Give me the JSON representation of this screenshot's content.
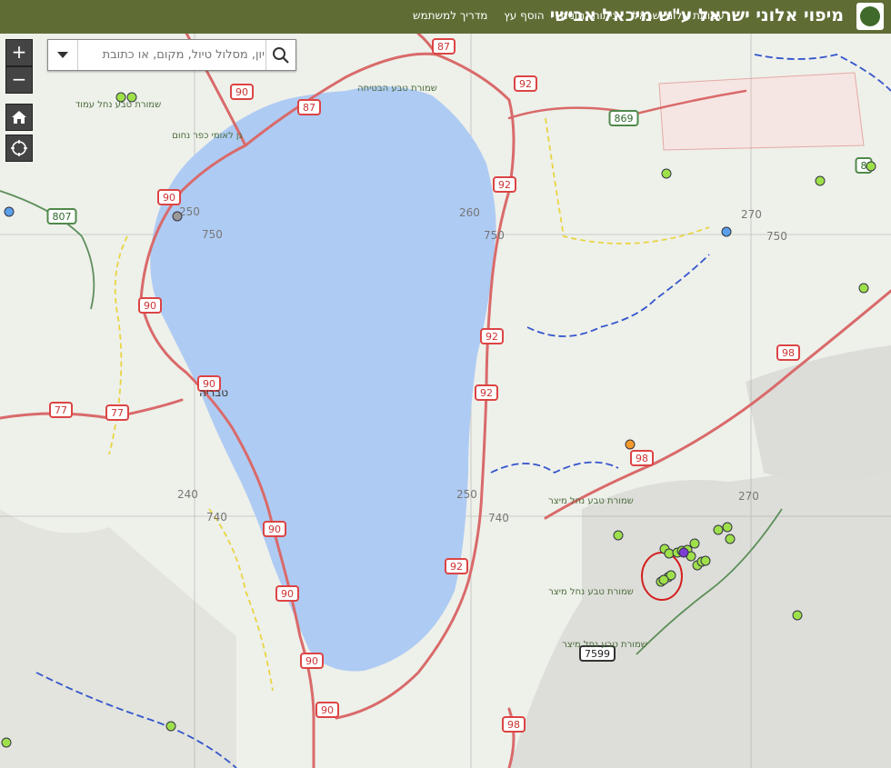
{
  "header": {
    "title": "מיפוי אלוני ישראל ע\"ש מיכאל אבישי",
    "nav": [
      "עמותת אלוני ישראל",
      "ניתוח נתונים",
      "הוסף עץ",
      "מדריך למשתמש"
    ]
  },
  "search": {
    "placeholder": "יון, מסלול טיול, מקום, או כתובת"
  },
  "controls": {
    "zoom_in": "+",
    "zoom_out": "−"
  },
  "map": {
    "lake_color": "#aecbf3",
    "road_color": "#d96a6a",
    "road_shields": [
      "87",
      "87",
      "90",
      "90",
      "90",
      "90",
      "90",
      "90",
      "90",
      "90",
      "92",
      "92",
      "92",
      "92",
      "92",
      "98",
      "98",
      "98",
      "77",
      "77",
      "807",
      "869",
      "7599",
      "8"
    ],
    "grid_labels": [
      "250",
      "260",
      "270",
      "750",
      "750",
      "750",
      "740",
      "740",
      "240",
      "270",
      "250"
    ],
    "place_labels": [
      "שמורת טבע נחל עמוד",
      "גן לאומי כפר נחום",
      "שמורת טבע הבטיחה",
      "טבריה",
      "שמורת טבע נחל מיצר",
      "שמורת טבע נחל מיצר",
      "שמורת טבע נחל מיצר"
    ],
    "highlight_color": "#d42020",
    "marker_color": "#9ee04a"
  }
}
